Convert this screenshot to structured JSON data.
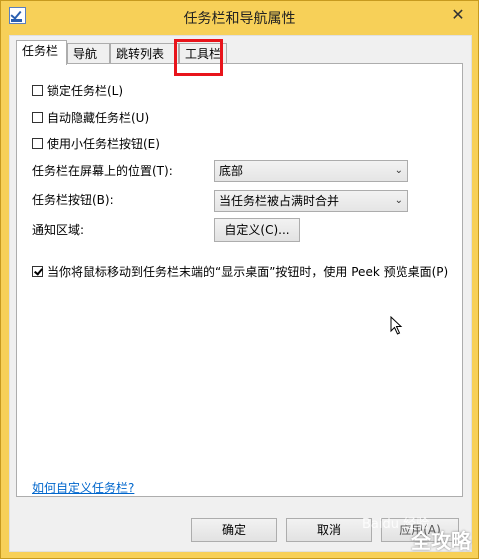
{
  "window": {
    "title": "任务栏和导航属性",
    "close_symbol": "✕"
  },
  "tabs": [
    {
      "label": "任务栏",
      "active": true
    },
    {
      "label": "导航",
      "active": false
    },
    {
      "label": "跳转列表",
      "active": false
    },
    {
      "label": "工具栏",
      "active": false,
      "highlighted": true
    }
  ],
  "options": {
    "lock_taskbar": {
      "label": "锁定任务栏(L)",
      "checked": false
    },
    "auto_hide": {
      "label": "自动隐藏任务栏(U)",
      "checked": false
    },
    "small_buttons": {
      "label": "使用小任务栏按钮(E)",
      "checked": false
    },
    "position": {
      "label": "任务栏在屏幕上的位置(T):",
      "value": "底部"
    },
    "buttons": {
      "label": "任务栏按钮(B):",
      "value": "当任务栏被占满时合并"
    },
    "notification": {
      "label": "通知区域:",
      "button": "自定义(C)..."
    },
    "peek": {
      "label": "当你将鼠标移动到任务栏末端的“显示桌面”按钮时，使用 Peek 预览桌面(P)",
      "checked": true
    }
  },
  "help_link": "如何自定义任务栏?",
  "footer": {
    "ok": "确定",
    "cancel": "取消",
    "apply": "应用(A)"
  },
  "watermark": {
    "text1": "Baidu 经验",
    "text2": "全攻略"
  },
  "colors": {
    "frame": "#f7d058",
    "highlight": "#e8141b",
    "link": "#0066cc"
  }
}
